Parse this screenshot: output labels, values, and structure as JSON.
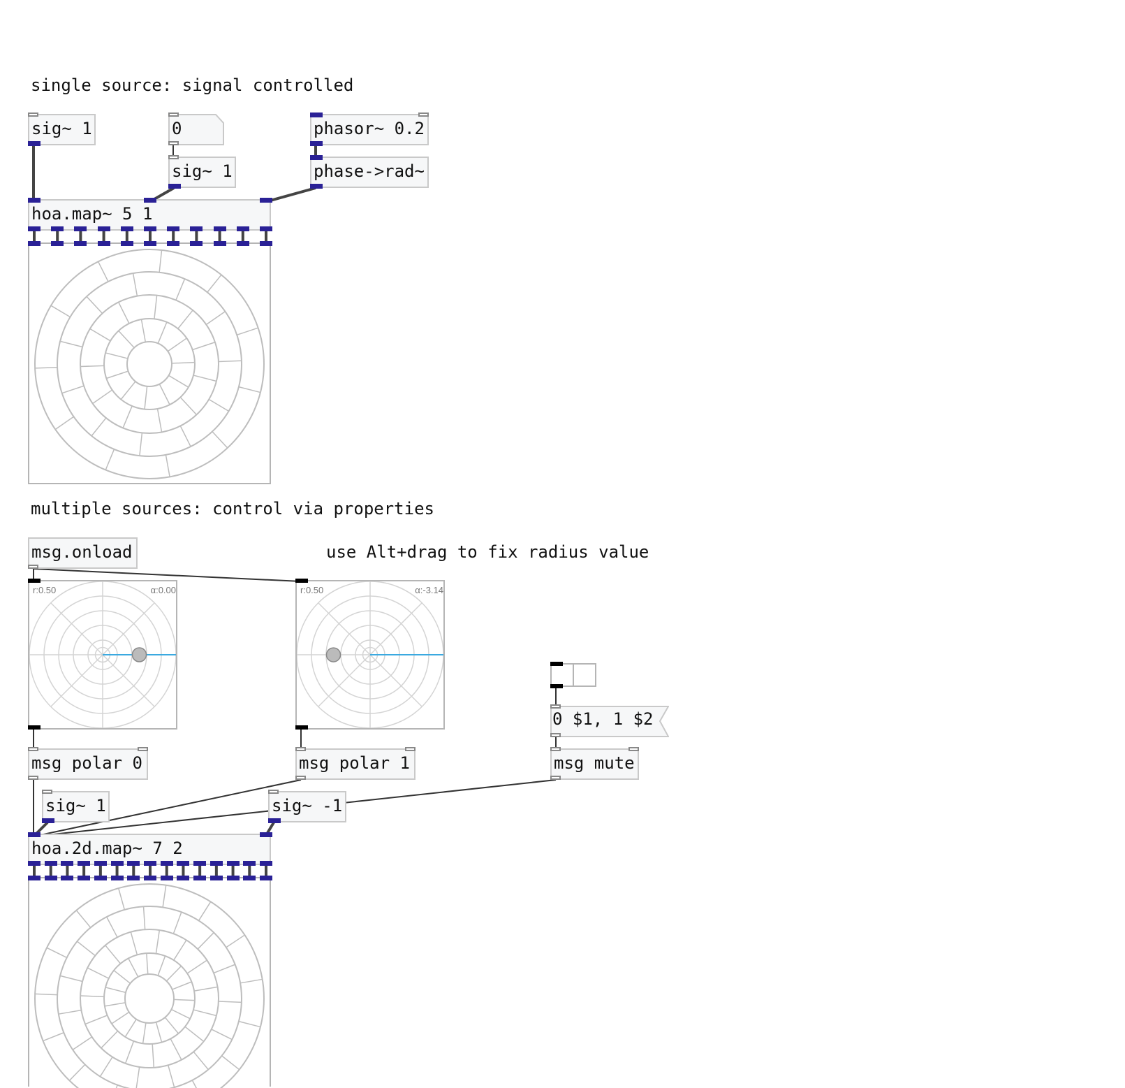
{
  "comments": {
    "single_source": "single source: signal controlled",
    "multiple_sources": "multiple sources: control via properties",
    "alt_drag_hint": "use Alt+drag to fix radius value"
  },
  "objects": {
    "sig1_a": "sig~ 1",
    "num0": "0",
    "phasor": "phasor~ 0.2",
    "sig1_b": "sig~ 1",
    "phase_rad": "phase->rad~",
    "hoa_map": "hoa.map~ 5 1",
    "msg_onload": "msg.onload",
    "msg_polar0": "msg polar 0",
    "msg_polar1": "msg polar 1",
    "list_msg": "0 $1, 1 $2",
    "msg_mute": "msg mute",
    "sig1_c": "sig~ 1",
    "sig_neg1": "sig~ -1",
    "hoa_2d_map": "hoa.2d.map~ 7 2"
  },
  "polar_planes": [
    {
      "radius_label": "r:0.50",
      "angle_label": "α:0.00",
      "radius": 0.5,
      "angle": 0.0
    },
    {
      "radius_label": "r:0.50",
      "angle_label": "α:-3.14",
      "radius": 0.5,
      "angle": -3.14
    }
  ],
  "colors": {
    "signal_cord": "#444444",
    "signal_tab": "#2a2196",
    "control_cord": "#333333",
    "grid": "#bdbdbd",
    "polar_line": "#3aa9e0",
    "knob": "#bbbbbb"
  }
}
